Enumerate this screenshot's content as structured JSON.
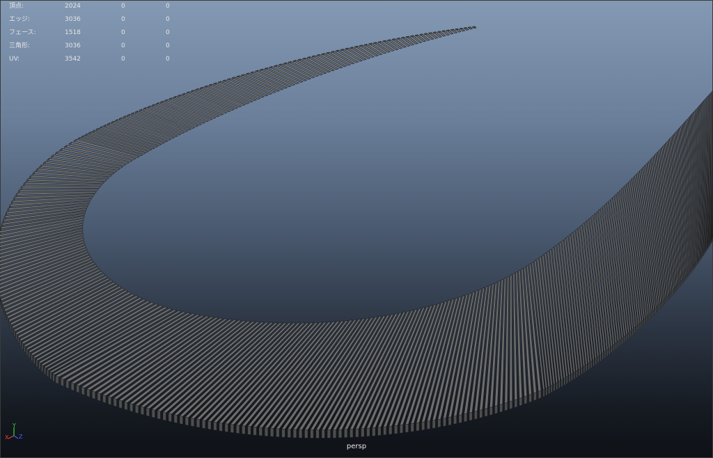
{
  "viewport": {
    "camera": "persp",
    "background_colors": {
      "top": "#8499b3",
      "bottom": "#0e1116"
    }
  },
  "heads_up_display": {
    "rows": [
      {
        "label": "頂点:",
        "count": "2024",
        "selected": "0",
        "uv_or_component": "0"
      },
      {
        "label": "エッジ:",
        "count": "3036",
        "selected": "0",
        "uv_or_component": "0"
      },
      {
        "label": "フェース:",
        "count": "1518",
        "selected": "0",
        "uv_or_component": "0"
      },
      {
        "label": "三角形:",
        "count": "3036",
        "selected": "0",
        "uv_or_component": "0"
      },
      {
        "label": "UV:",
        "count": "3542",
        "selected": "0",
        "uv_or_component": "0"
      }
    ]
  },
  "model": {
    "description_color": "#6e6e6e",
    "plank_color": "#6e6e6e",
    "edge_color": "#1a1a1a"
  },
  "axis_gizmo": {
    "x_label": "X",
    "y_label": "Y",
    "z_label": "Z",
    "x_color": "#e04040",
    "y_color": "#40d040",
    "z_color": "#4060ff"
  }
}
